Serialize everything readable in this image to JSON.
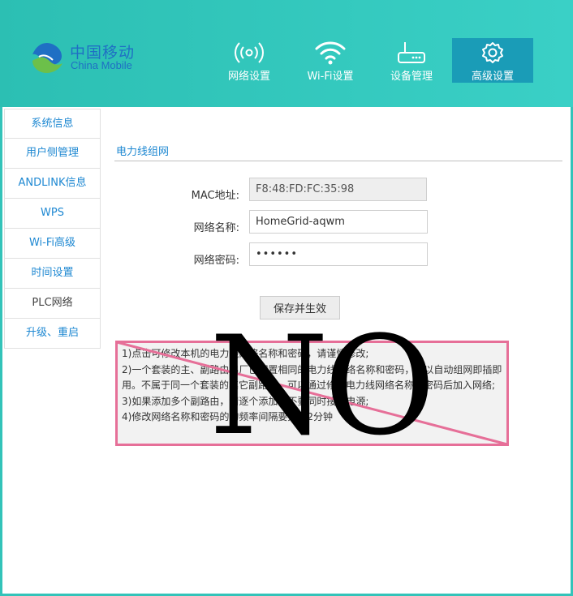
{
  "brand": {
    "name_cn": "中国移动",
    "name_en": "China Mobile"
  },
  "nav": [
    {
      "label": "网络设置",
      "icon": "network-signal-icon",
      "active": false
    },
    {
      "label": "Wi-Fi设置",
      "icon": "wifi-icon",
      "active": false
    },
    {
      "label": "设备管理",
      "icon": "router-icon",
      "active": false
    },
    {
      "label": "高级设置",
      "icon": "gear-icon",
      "active": true
    }
  ],
  "sidebar": {
    "items": [
      {
        "label": "系统信息"
      },
      {
        "label": "用户侧管理"
      },
      {
        "label": "ANDLINK信息"
      },
      {
        "label": "WPS"
      },
      {
        "label": "Wi-Fi高级"
      },
      {
        "label": "时间设置"
      },
      {
        "label": "PLC网络",
        "active": true
      },
      {
        "label": "升级、重启"
      }
    ]
  },
  "main": {
    "section_title": "电力线组网",
    "form": {
      "mac_label": "MAC地址:",
      "mac_value": "F8:48:FD:FC:35:98",
      "name_label": "网络名称:",
      "name_value": "HomeGrid-aqwm",
      "password_label": "网络密码:",
      "password_value": "••••••"
    },
    "save_label": "保存并生效",
    "notes": [
      "1)点击可修改本机的电力线网络名称和密码，请谨慎修改;",
      "2)一个套装的主、副路由出厂已配置相同的电力线网络名称和密码，可以自动组网即插即用。不属于同一个套装的其它副路由，可以通过修改电力线网络名称和密码后加入网络;",
      "3)如果添加多个副路由，请逐个添加，不要同时接入电源;",
      "4)修改网络名称和密码的的频率间隔要大于2分钟"
    ]
  },
  "overlay": {
    "text": "NO",
    "frame_color": "#e66f98"
  },
  "colors": {
    "header": "#33c8be",
    "accent": "#1e88d2",
    "active_nav": "#1a9cb7"
  }
}
